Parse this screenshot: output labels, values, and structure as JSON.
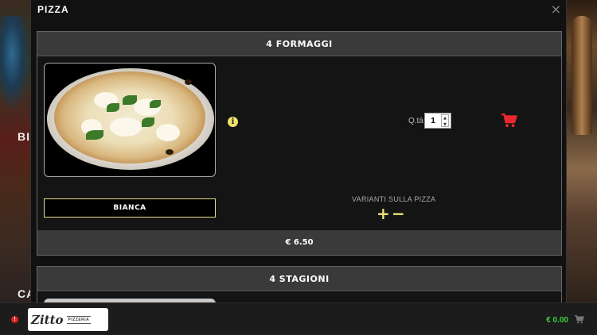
{
  "background": {
    "left_labels": [
      "BI",
      "CA"
    ]
  },
  "modal": {
    "title": "PIZZA",
    "close_glyph": "×"
  },
  "items": [
    {
      "name": "4 FORMAGGI",
      "info_glyph": "i",
      "quantity_label": "Q.tà",
      "quantity_value": "1",
      "base_button": "BIANCA",
      "variants_label": "VARIANTI SULLA PIZZA",
      "variant_add": "+",
      "variant_remove": "−",
      "price": "€ 6.50"
    },
    {
      "name": "4 STAGIONI"
    }
  ],
  "footer": {
    "alert_glyph": "!",
    "logo_text": "Zitto",
    "logo_tag": "PIZZERIA",
    "total": "€ 0.00"
  },
  "colors": {
    "cart_red": "#e8282e",
    "accent_yellow": "#f1e676",
    "total_green": "#3bd13b"
  }
}
